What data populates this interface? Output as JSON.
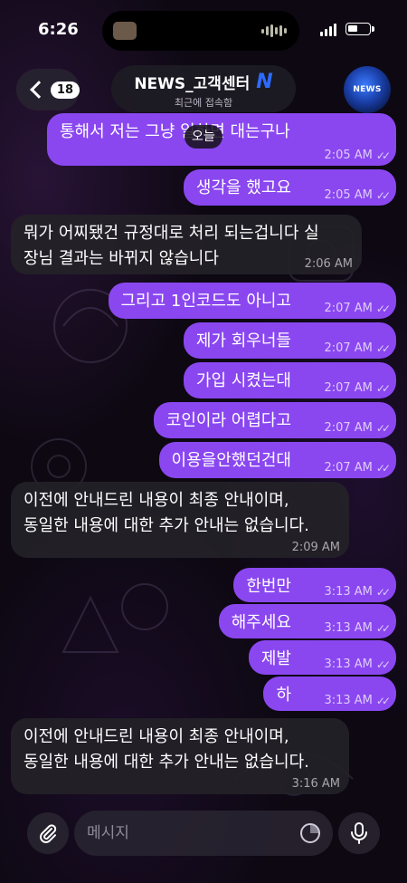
{
  "status_bar": {
    "time": "6:26"
  },
  "header": {
    "back_count": "18",
    "title": "NEWS_고객센터",
    "verified_mark": "N",
    "subtitle": "최근에 접속함",
    "avatar_label": "NEWS"
  },
  "date_chip": "오늘",
  "messages": [
    {
      "dir": "out",
      "text": "통해서 저는 그냥 일하면 대는구나",
      "time": "2:05 AM",
      "status": "read"
    },
    {
      "dir": "out",
      "text": "생각을 했고요",
      "time": "2:05 AM",
      "status": "read"
    },
    {
      "dir": "in",
      "text": "뭐가 어찌됐건 규정대로 처리 되는겁니다 실\n장님 결과는 바뀌지 않습니다",
      "time": "2:06 AM"
    },
    {
      "dir": "out",
      "text": "그리고 1인코드도 아니고",
      "time": "2:07 AM",
      "status": "read"
    },
    {
      "dir": "out",
      "text": "제가 회우너들",
      "time": "2:07 AM",
      "status": "read"
    },
    {
      "dir": "out",
      "text": "가입 시켰는대",
      "time": "2:07 AM",
      "status": "read"
    },
    {
      "dir": "out",
      "text": "코인이라 어렵다고",
      "time": "2:07 AM",
      "status": "read"
    },
    {
      "dir": "out",
      "text": "이용을안했던건대",
      "time": "2:07 AM",
      "status": "read"
    },
    {
      "dir": "in",
      "text": "이전에 안내드린 내용이 최종 안내이며,\n동일한 내용에 대한 추가 안내는 없습니다.",
      "time": "2:09 AM"
    },
    {
      "dir": "out",
      "text": "한번만",
      "time": "3:13 AM",
      "status": "read"
    },
    {
      "dir": "out",
      "text": "해주세요",
      "time": "3:13 AM",
      "status": "read"
    },
    {
      "dir": "out",
      "text": "제발",
      "time": "3:13 AM",
      "status": "read"
    },
    {
      "dir": "out",
      "text": "하",
      "time": "3:13 AM",
      "status": "read"
    },
    {
      "dir": "in",
      "text": "이전에 안내드린 내용이 최종 안내이며,\n동일한 내용에 대한 추가 안내는 없습니다.",
      "time": "3:16 AM"
    }
  ],
  "composer": {
    "placeholder": "메시지"
  },
  "colors": {
    "outgoing": "#8a47f0",
    "incoming": "#242128",
    "verified": "#2d6bff"
  }
}
